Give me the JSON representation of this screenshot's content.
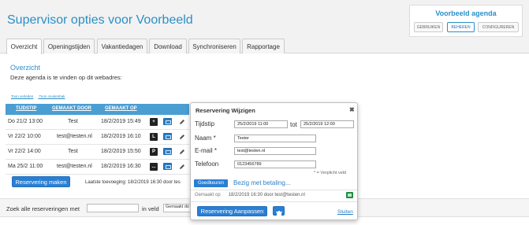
{
  "page": {
    "title": "Supervisor opties voor Voorbeeld"
  },
  "agenda_panel": {
    "title": "Voorbeeld agenda",
    "buttons": [
      "GEBRUIKEN",
      "BEHEREN",
      "CONFIGUREREN"
    ],
    "active": "BEHEREN"
  },
  "tabs": [
    "Overzicht",
    "Openingstijden",
    "Vakantiedagen",
    "Download",
    "Synchroniseren",
    "Rapportage"
  ],
  "active_tab": "Overzicht",
  "overview": {
    "title": "Overzicht",
    "description": "Deze agenda is te vinden op dit webadres:",
    "links": [
      "Toon verleden",
      "Toon onuitenbak"
    ]
  },
  "table": {
    "headers": [
      "TIJDSTIP",
      "GEMAAKT DOOR",
      "GEMAAKT OP"
    ],
    "rows": [
      {
        "time": "Do 21/2 13:00",
        "by": "Test",
        "on": "18/2/2019 15:49",
        "badge": "+"
      },
      {
        "time": "Vr 22/2 10:00",
        "by": "test@testen.nl",
        "on": "18/2/2019 16:10",
        "badge": "L"
      },
      {
        "time": "Vr 22/2 14:00",
        "by": "Test",
        "on": "18/2/2019 15:50",
        "badge": "P"
      },
      {
        "time": "Ma 25/2 11:00",
        "by": "test@testen.nl",
        "on": "18/2/2019 16:30",
        "badge": "..."
      }
    ]
  },
  "make_button": "Reservering maken",
  "latest_addition": "Laatste toevoeging: 18/2/2019 16:30 door tes",
  "search": {
    "label": "Zoek alle reserveringen met",
    "value": "",
    "field_label": "in veld",
    "field_value": "Gemaakt do"
  },
  "modal": {
    "title": "Reservering Wijzigen",
    "close_symbol": "✖",
    "time_label": "Tijdstip",
    "from": "25/2/2019 11:00",
    "to_label": "tot",
    "to": "25/2/2019 12:00",
    "name_label": "Naam *",
    "name": "Tester",
    "email_label": "E-mail *",
    "email": "test@testen.nl",
    "phone_label": "Telefoon",
    "phone": "0123456789",
    "required_note": "* = Verplicht veld",
    "approve_badge": "Goedkeuren",
    "payment_status": "Bezig met betaling...",
    "created_label": "Gemaakt op",
    "created_value": "18/2/2019 16:30 door test@testen.nl",
    "save_button": "Reservering Aanpassen",
    "close_link": "Sluiten"
  },
  "colors": {
    "accent": "#2a8fc8",
    "button": "#2a7fd4",
    "header": "#4a9ed2"
  },
  "icons": [
    "mail-icon",
    "edit-icon",
    "trash-icon",
    "spreadsheet-icon",
    "close-icon"
  ]
}
